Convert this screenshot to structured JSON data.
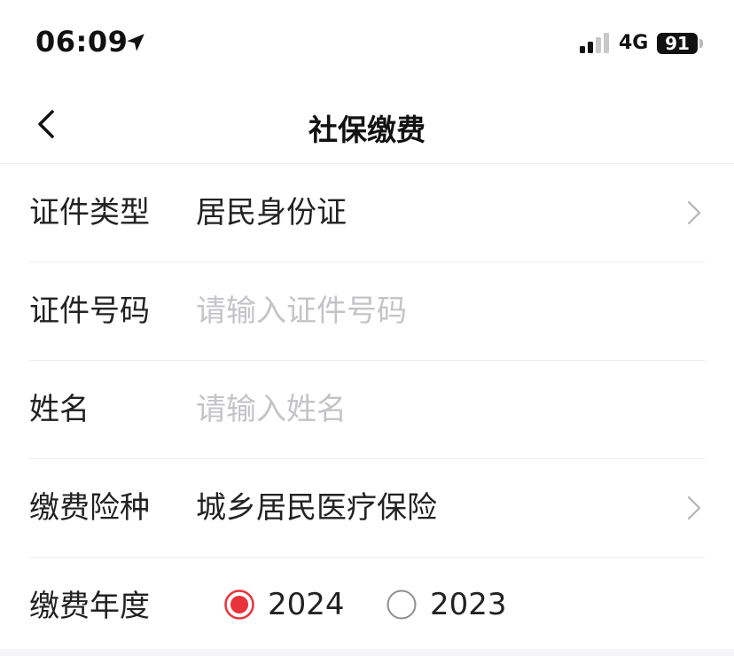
{
  "status_bar": {
    "time": "06:09",
    "network": "4G",
    "battery": "91"
  },
  "nav": {
    "title": "社保缴费"
  },
  "form": {
    "id_type": {
      "label": "证件类型",
      "value": "居民身份证"
    },
    "id_number": {
      "label": "证件号码",
      "value": "",
      "placeholder": "请输入证件号码"
    },
    "name": {
      "label": "姓名",
      "value": "",
      "placeholder": "请输入姓名"
    },
    "insurance_type": {
      "label": "缴费险种",
      "value": "城乡居民医疗保险"
    },
    "year": {
      "label": "缴费年度",
      "options": [
        {
          "label": "2024",
          "selected": true
        },
        {
          "label": "2023",
          "selected": false
        }
      ]
    }
  },
  "colors": {
    "accent": "#e8333a",
    "placeholder": "#c4c4c8",
    "divider": "#ececec"
  }
}
